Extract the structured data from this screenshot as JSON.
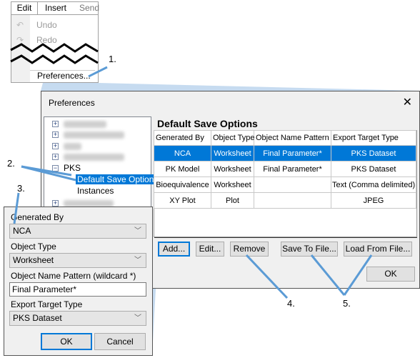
{
  "menu": {
    "tabs": [
      "Edit",
      "Insert",
      "Send"
    ],
    "items": {
      "undo": "Undo",
      "redo": "Redo",
      "preferences": "Preferences..."
    }
  },
  "prefs": {
    "title": "Preferences",
    "tree": {
      "pks": "PKS",
      "default_save": "Default Save Options",
      "instances": "Instances"
    },
    "section_title": "Default Save Options",
    "columns": [
      "Generated By",
      "Object Type",
      "Object Name Pattern",
      "Export Target Type"
    ],
    "rows": [
      [
        "NCA",
        "Worksheet",
        "Final Parameter*",
        "PKS Dataset"
      ],
      [
        "PK Model",
        "Worksheet",
        "Final Parameter*",
        "PKS Dataset"
      ],
      [
        "Bioequivalence",
        "Worksheet",
        "",
        "Text (Comma delimited)"
      ],
      [
        "XY Plot",
        "Plot",
        "",
        "JPEG"
      ]
    ],
    "buttons": {
      "add": "Add...",
      "edit": "Edit...",
      "remove": "Remove",
      "save": "Save To File...",
      "load": "Load From File...",
      "ok": "OK"
    }
  },
  "edit_dialog": {
    "generated_by_label": "Generated By",
    "generated_by": "NCA",
    "object_type_label": "Object Type",
    "object_type": "Worksheet",
    "pattern_label": "Object Name Pattern (wildcard *)",
    "pattern": "Final Parameter*",
    "export_label": "Export Target Type",
    "export": "PKS Dataset",
    "ok": "OK",
    "cancel": "Cancel"
  },
  "callouts": [
    "1.",
    "2.",
    "3.",
    "4.",
    "5."
  ],
  "colors": {
    "selection": "#0078d7",
    "callout_line": "#5b9bd5",
    "beam": "#c6dbf0"
  }
}
